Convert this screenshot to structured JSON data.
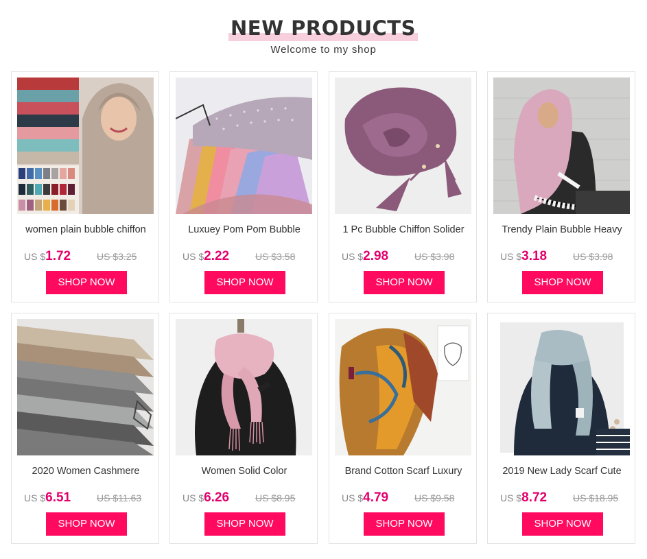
{
  "header": {
    "title": "NEW PRODUCTS",
    "subtitle": "Welcome to my shop"
  },
  "colors": {
    "accent": "#ff0a5e",
    "price": "#e3006d",
    "underline": "#f7cfdd"
  },
  "products": [
    {
      "name": "women plain bubble chiffon",
      "currency": "US $",
      "price": "1.72",
      "original": "US $3.25",
      "button": "SHOP NOW",
      "image": "hijab-model-photo"
    },
    {
      "name": "Luxuey Pom Pom Bubble",
      "currency": "US $",
      "price": "2.22",
      "original": "US $3.58",
      "button": "SHOP NOW",
      "image": "pom-pom-scarves-photo"
    },
    {
      "name": "1 Pc Bubble Chiffon Solider",
      "currency": "US $",
      "price": "2.98",
      "original": "US $3.98",
      "button": "SHOP NOW",
      "image": "purple-tassel-scarf-photo"
    },
    {
      "name": "Trendy Plain Bubble Heavy",
      "currency": "US $",
      "price": "3.18",
      "original": "US $3.98",
      "button": "SHOP NOW",
      "image": "pink-hijab-model-photo"
    },
    {
      "name": "2020 Women Cashmere",
      "currency": "US $",
      "price": "6.51",
      "original": "US $11.63",
      "button": "SHOP NOW",
      "image": "cashmere-stack-photo"
    },
    {
      "name": "Women Solid Color",
      "currency": "US $",
      "price": "6.26",
      "original": "US $8.95",
      "button": "SHOP NOW",
      "image": "pink-tassel-scarf-photo"
    },
    {
      "name": "Brand Cotton Scarf Luxury",
      "currency": "US $",
      "price": "4.79",
      "original": "US $9.58",
      "button": "SHOP NOW",
      "image": "printed-scarf-photo"
    },
    {
      "name": "2019 New Lady Scarf Cute",
      "currency": "US $",
      "price": "8.72",
      "original": "US $18.95",
      "button": "SHOP NOW",
      "image": "knit-scarf-photo"
    }
  ]
}
